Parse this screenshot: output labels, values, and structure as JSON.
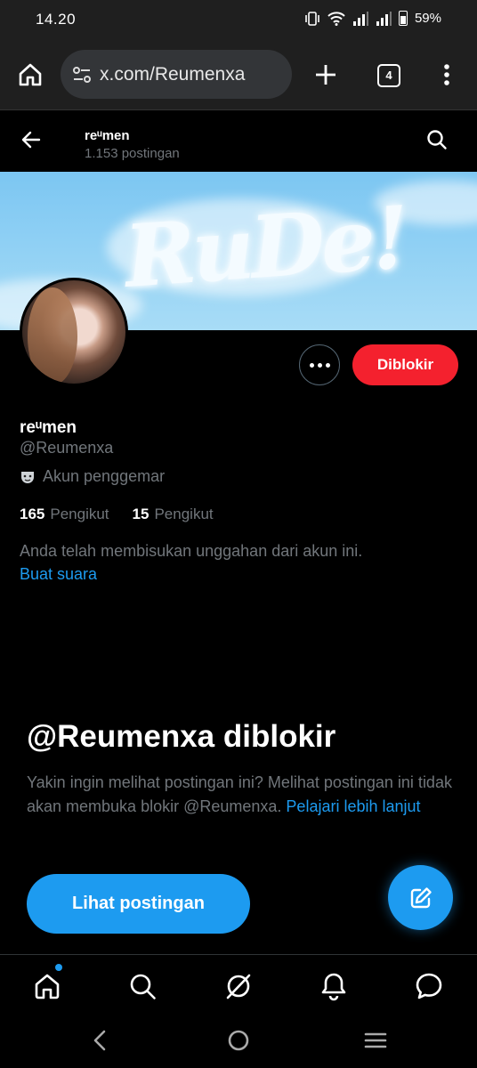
{
  "status_bar": {
    "time": "14.20",
    "battery": "59%"
  },
  "browser": {
    "url": "x.com/Reumenxa",
    "tab_count": "4"
  },
  "header": {
    "name": "reᵘmen",
    "post_count": "1.153 postingan"
  },
  "banner": {
    "text": "RuDe!"
  },
  "profile": {
    "name": "reᵘmen",
    "handle": "@Reumenxa",
    "label": "Akun penggemar",
    "followers_count": "165",
    "followers_label": "Pengikut",
    "following_count": "15",
    "following_label": "Pengikut",
    "muted_note": "Anda telah membisukan unggahan dari akun ini.",
    "unmute_link": "Buat suara"
  },
  "actions": {
    "blocked_label": "Diblokir"
  },
  "blocked_panel": {
    "title": "@Reumenxa diblokir",
    "description": "Yakin ingin melihat postingan ini? Melihat postingan ini tidak akan membuka blokir @Reumenxa.",
    "learn_more": "Pelajari lebih lanjut",
    "button": "Lihat postingan"
  },
  "bottom_nav": {
    "items": [
      "home-icon",
      "search-icon",
      "grok-icon",
      "notifications-icon",
      "messages-icon"
    ]
  },
  "colors": {
    "accent": "#1d9bf0",
    "danger": "#f4212e",
    "muted": "#71767b"
  }
}
